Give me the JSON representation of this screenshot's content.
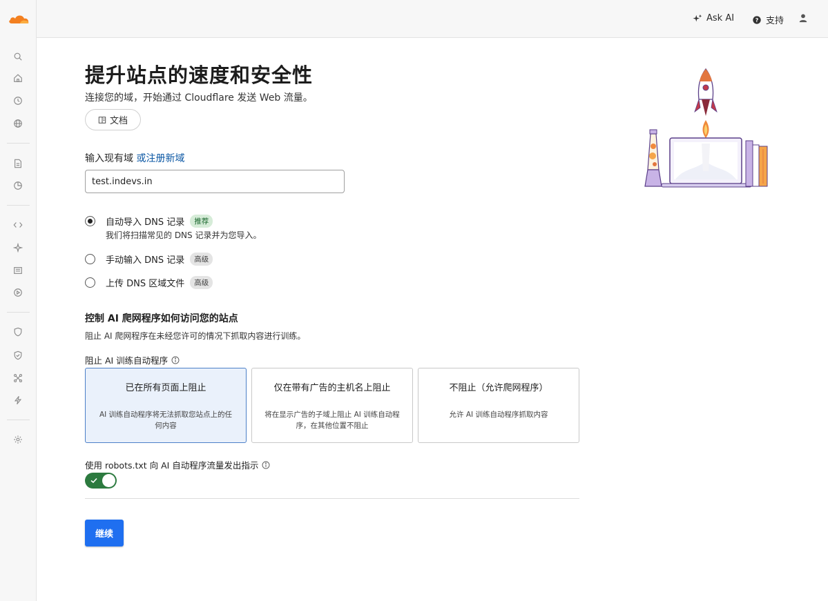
{
  "topbar": {
    "ask_ai": "Ask AI",
    "support": "支持"
  },
  "sidebar": {
    "icons": [
      "search-icon",
      "home-icon",
      "history-icon",
      "globe-icon",
      "document-icon",
      "chart-icon",
      "code-icon",
      "sparkle-icon",
      "list-icon",
      "play-icon",
      "shield-icon",
      "shield-check-icon",
      "network-icon",
      "bolt-icon",
      "gear-icon"
    ]
  },
  "main": {
    "title": "提升站点的速度和安全性",
    "subtitle": "连接您的域，开始通过 Cloudflare 发送 Web 流量。",
    "docs_label": "文档",
    "domain_label": "输入现有域",
    "register_link": "或注册新域",
    "domain_value": "test.indevs.in"
  },
  "dns_options": [
    {
      "label": "自动导入 DNS 记录",
      "badge": "推荐",
      "selected": true,
      "desc": "我们将扫描常见的 DNS 记录并为您导入。"
    },
    {
      "label": "手动输入 DNS 记录",
      "badge": "高级",
      "selected": false
    },
    {
      "label": "上传 DNS 区域文件",
      "badge": "高级",
      "selected": false
    }
  ],
  "ai": {
    "title": "控制 AI 爬网程序如何访问您的站点",
    "desc": "阻止 AI 爬网程序在未经您许可的情况下抓取内容进行训练。",
    "block_label": "阻止 AI 训练自动程序",
    "options": [
      {
        "title": "已在所有页面上阻止",
        "desc": "AI 训练自动程序将无法抓取您站点上的任何内容",
        "selected": true
      },
      {
        "title": "仅在带有广告的主机名上阻止",
        "desc": "将在显示广告的子域上阻止 AI 训练自动程序，在其他位置不阻止",
        "selected": false
      },
      {
        "title": "不阻止（允许爬网程序）",
        "desc": "允许 AI 训练自动程序抓取内容",
        "selected": false
      }
    ],
    "robots_label": "使用 robots.txt 向 AI 自动程序流量发出指示",
    "robots_enabled": true
  },
  "continue_label": "继续",
  "colors": {
    "accent": "#1f6ff0",
    "toggle_on": "#2c7a3f",
    "link": "#0b57a4",
    "brand_orange": "#f38020"
  }
}
